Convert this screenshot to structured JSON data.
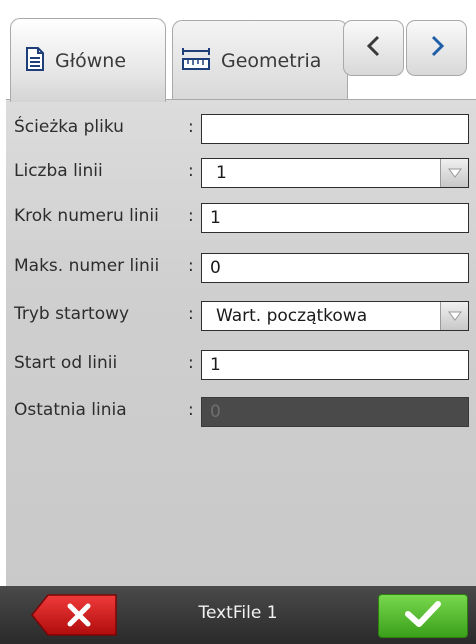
{
  "tabs": [
    {
      "label": "Główne",
      "icon": "document-icon",
      "active": true
    },
    {
      "label": "Geometria",
      "icon": "ruler-icon",
      "active": false
    }
  ],
  "nav": {
    "prev_icon": "chevron-left-icon",
    "next_icon": "chevron-right-icon"
  },
  "form": {
    "colon": ":",
    "rows": [
      {
        "label": "Ścieżka pliku",
        "value": "",
        "type": "text"
      },
      {
        "label": "Liczba linii",
        "value": "1",
        "type": "select"
      },
      {
        "label": "Krok numeru linii",
        "value": "1",
        "type": "text"
      },
      {
        "label": "Maks. numer linii",
        "value": "0",
        "type": "text"
      },
      {
        "label": "Tryb startowy",
        "value": "Wart. początkowa",
        "type": "select"
      },
      {
        "label": "Start od linii",
        "value": "1",
        "type": "text"
      },
      {
        "label": "Ostatnia linia",
        "value": "0",
        "type": "text",
        "disabled": true
      }
    ]
  },
  "bottom": {
    "title": "TextFile 1",
    "cancel_icon": "close-icon",
    "ok_icon": "checkmark-icon"
  },
  "colors": {
    "ok_green": "#4cbf24",
    "cancel_red": "#d01818",
    "panel_gray": "#cfcfcf",
    "bar_dark": "#333333"
  }
}
